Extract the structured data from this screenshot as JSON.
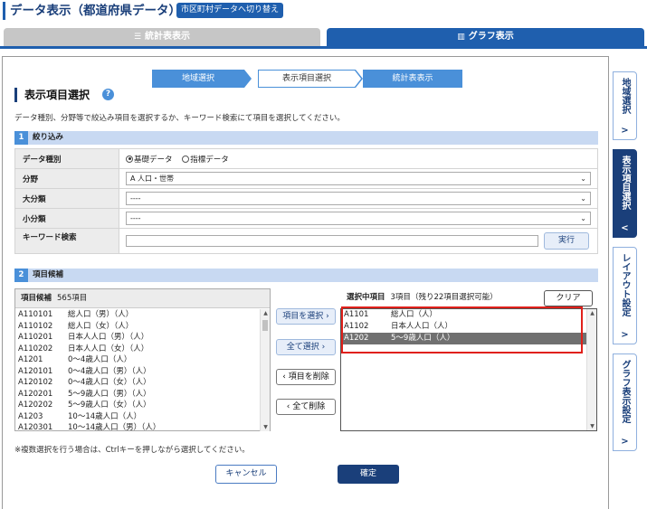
{
  "header": {
    "title": "データ表示（都道府県データ）",
    "switch_label": "市区町村データへ切り替え"
  },
  "tabs": {
    "table_view": "統計表表示",
    "graph_view": "グラフ表示"
  },
  "steps": [
    "地域選択",
    "表示項目選択",
    "統計表表示"
  ],
  "section": {
    "title": "表示項目選択",
    "help": "?",
    "description": "データ種別、分野等で絞込み項目を選択するか、キーワード検索にて項目を選択してください。"
  },
  "filter": {
    "num": "1",
    "title": "絞り込み",
    "data_type_label": "データ種別",
    "radio_basic": "基礎データ",
    "radio_indicator": "指標データ",
    "field_label": "分野",
    "field_value": "A 人口・世帯",
    "major_label": "大分類",
    "major_value": "----",
    "minor_label": "小分類",
    "minor_value": "----",
    "keyword_label": "キーワード検索",
    "run_label": "実行"
  },
  "candidates": {
    "num": "2",
    "title": "項目候補",
    "list_title": "項目候補",
    "count": "565項目",
    "items": [
      {
        "code": "A110101",
        "name": "総人口（男）（人）"
      },
      {
        "code": "A110102",
        "name": "総人口（女）（人）"
      },
      {
        "code": "A110201",
        "name": "日本人人口（男）（人）"
      },
      {
        "code": "A110202",
        "name": "日本人人口（女）（人）"
      },
      {
        "code": "A1201",
        "name": "0～4歳人口（人）"
      },
      {
        "code": "A120101",
        "name": "0～4歳人口（男）（人）"
      },
      {
        "code": "A120102",
        "name": "0～4歳人口（女）（人）"
      },
      {
        "code": "A120201",
        "name": "5～9歳人口（男）（人）"
      },
      {
        "code": "A120202",
        "name": "5～9歳人口（女）（人）"
      },
      {
        "code": "A1203",
        "name": "10～14歳人口（人）"
      },
      {
        "code": "A120301",
        "name": "10～14歳人口（男）（人）"
      }
    ]
  },
  "buttons": {
    "select": "項目を選択",
    "select_all": "全て選択",
    "remove": "項目を削除",
    "remove_all": "全て削除",
    "clear": "クリア",
    "cancel": "キャンセル",
    "ok": "確定"
  },
  "selected": {
    "title": "選択中項目",
    "count": "3項目",
    "remaining": "（残り22項目選択可能）",
    "items": [
      {
        "code": "A1101",
        "name": "総人口（人）"
      },
      {
        "code": "A1102",
        "name": "日本人人口（人）"
      },
      {
        "code": "A1202",
        "name": "5～9歳人口（人）"
      }
    ]
  },
  "note": "※複数選択を行う場合は、Ctrlキーを押しながら選択してください。",
  "side_tabs": [
    {
      "label": "地域選択",
      "chevron": ">"
    },
    {
      "label": "表示項目選択",
      "chevron": "<"
    },
    {
      "label": "レイアウト設定",
      "chevron": ">"
    },
    {
      "label": "グラフ表示設定",
      "chevron": ">"
    }
  ]
}
